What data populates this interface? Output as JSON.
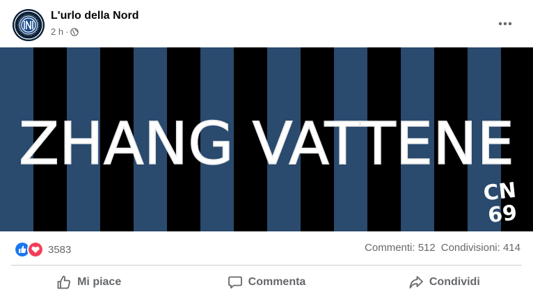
{
  "post": {
    "page_name": "L'urlo della Nord",
    "time": "2 h",
    "separator": "·",
    "privacy_icon": "globe-icon",
    "more_icon": "more-options-icon"
  },
  "banner": {
    "headline": "ZHANG VATTENE",
    "signature_line1": "CN",
    "signature_line2": "69",
    "stripe_colors": [
      "#2a4a6e",
      "#000000"
    ]
  },
  "stats": {
    "reaction_icons": [
      "like-icon",
      "love-icon"
    ],
    "reaction_count": "3583",
    "comments": "Commenti: 512",
    "shares": "Condivisioni: 414"
  },
  "actions": {
    "like": "Mi piace",
    "comment": "Commenta",
    "share": "Condividi"
  },
  "colors": {
    "text_primary": "#050505",
    "text_secondary": "#65676b",
    "like_blue": "#1877f2",
    "love_red": "#f33e58"
  }
}
